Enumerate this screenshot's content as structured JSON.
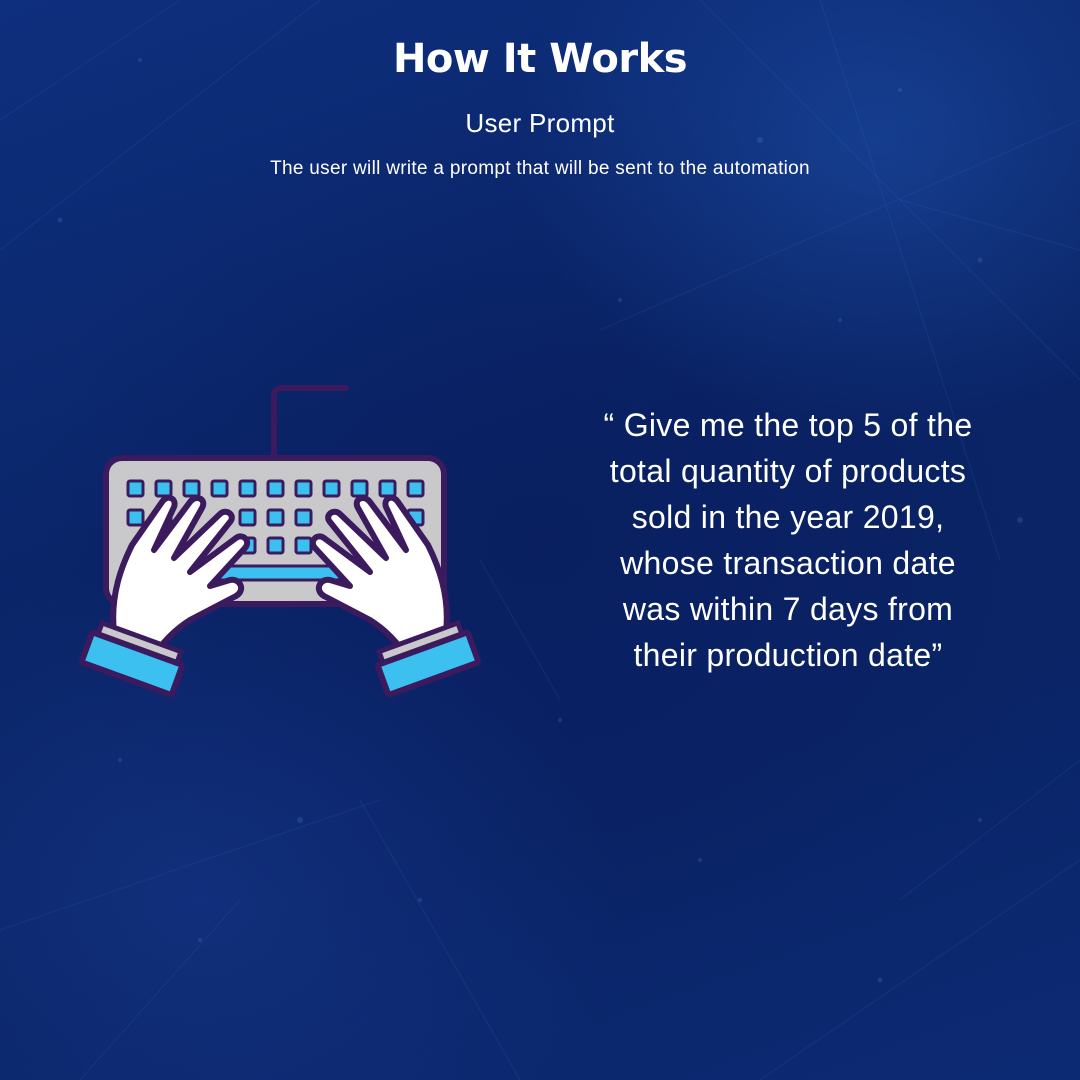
{
  "header": {
    "title": "How It Works",
    "subtitle": "User Prompt",
    "caption": "The user will write a prompt that will be sent to the automation"
  },
  "illustration": {
    "icon": "typing-on-keyboard-icon"
  },
  "quote": {
    "text": "“ Give me the top 5 of the\ntotal quantity of products\nsold in the year 2019,\nwhose transaction date\nwas within 7 days from\ntheir production date”"
  },
  "colors": {
    "background": "#0b2870",
    "text": "#ffffff",
    "outline": "#3b1a5e",
    "keyboard": "#c9c9cc",
    "key_accent": "#3bc0f0"
  }
}
